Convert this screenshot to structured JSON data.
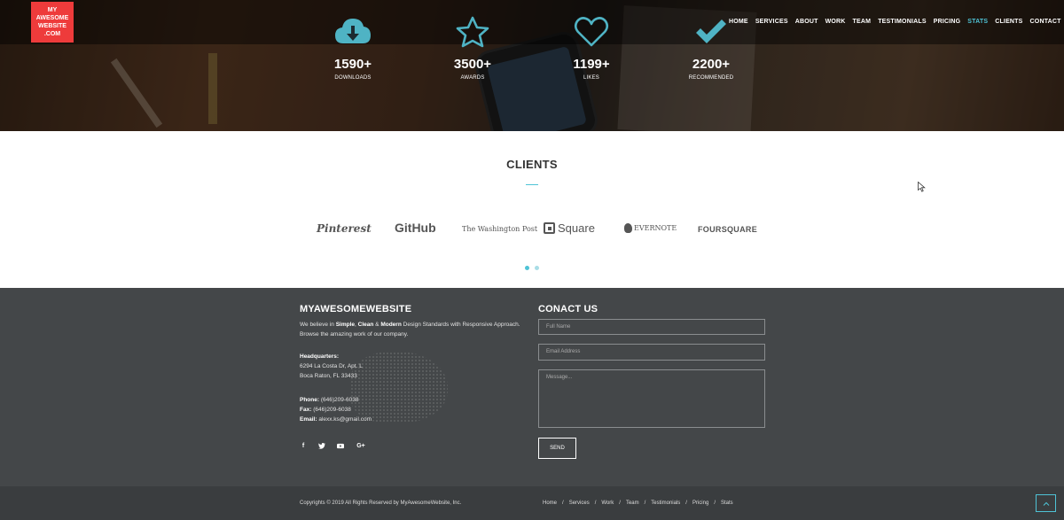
{
  "logo": {
    "lines": [
      "MY",
      "AWESOME",
      "WEBSITE",
      ".COM"
    ]
  },
  "nav": [
    {
      "label": "HOME",
      "active": false
    },
    {
      "label": "SERVICES",
      "active": false
    },
    {
      "label": "ABOUT",
      "active": false
    },
    {
      "label": "WORK",
      "active": false
    },
    {
      "label": "TEAM",
      "active": false
    },
    {
      "label": "TESTIMONIALS",
      "active": false
    },
    {
      "label": "PRICING",
      "active": false
    },
    {
      "label": "STATS",
      "active": true
    },
    {
      "label": "CLIENTS",
      "active": false
    },
    {
      "label": "CONTACT",
      "active": false
    }
  ],
  "stats": [
    {
      "icon": "cloud-download-icon",
      "value": "1590+",
      "label": "DOWNLOADS"
    },
    {
      "icon": "star-icon",
      "value": "3500+",
      "label": "AWARDS"
    },
    {
      "icon": "heart-icon",
      "value": "1199+",
      "label": "LIKES"
    },
    {
      "icon": "checkmark-icon",
      "value": "2200+",
      "label": "RECOMMENDED"
    }
  ],
  "clients": {
    "title": "CLIENTS",
    "logos": [
      "Pinterest",
      "GitHub",
      "The Washington Post",
      "Square",
      "EVERNOTE",
      "FOURSQUARE"
    ]
  },
  "about": {
    "title": "MYAWESOMEWEBSITE",
    "desc_prefix": "We believe in",
    "desc_simple": "Simple",
    "desc_clean": "Clean",
    "desc_amp": "&",
    "desc_modern": "Modern",
    "desc_suffix": "Design Standards with Responsive Approach.",
    "desc_line2": "Browse the amazing work of our company.",
    "hq_label": "Headquarters:",
    "hq_line1": "6294 La Costa Dr, Apt. L",
    "hq_line2": "Boca Raton, FL 33433",
    "phone_label": "Phone:",
    "phone": "(646)209-6038",
    "fax_label": "Fax:",
    "fax": "(646)209-6038",
    "email_label": "Email:",
    "email": "alexx.ks@gmail.com",
    "socials": [
      "facebook-icon",
      "twitter-icon",
      "youtube-icon",
      "google-plus-icon"
    ]
  },
  "contact": {
    "title": "CONACT US",
    "name_placeholder": "Full Name",
    "email_placeholder": "Email Address",
    "message_placeholder": "Message...",
    "send_label": "SEND"
  },
  "footer": {
    "copyright": "Copyrights © 2019 All Rights Reserved by MyAwesomeWebsite, Inc.",
    "links": [
      "Home",
      "Services",
      "Work",
      "Team",
      "Testimonials",
      "Pricing",
      "Stats"
    ],
    "separator": "/",
    "to_top_icon": "chevron-up-icon"
  },
  "colors": {
    "accent": "#4fc3d6",
    "logo_bg": "#ee3b3b",
    "footer_bg": "#444749"
  }
}
